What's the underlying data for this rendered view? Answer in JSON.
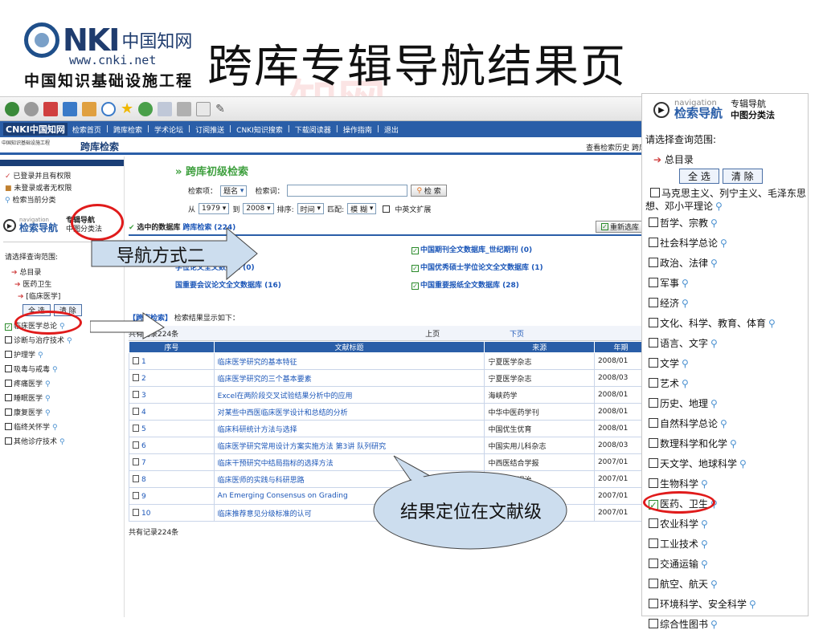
{
  "slide": {
    "title": "跨库专辑导航结果页",
    "watermark": "知网"
  },
  "logo": {
    "mark": "NKI",
    "cn_short": "中国知网",
    "url": "www.cnki.net",
    "cn_full": "中国知识基础设施工程"
  },
  "browser": {
    "nav_logo": "CNKI中国知网",
    "nav_items": [
      "检索首页",
      "跨库检索",
      "学术论坛",
      "订阅推送",
      "CNKI知识搜索",
      "下载阅读器",
      "操作指南",
      "退出"
    ],
    "site_sub": "中国知识基础设施工程",
    "page_title": "跨库检索",
    "history_link": "查看检索历史",
    "history_link2": "跨库"
  },
  "left_panel": {
    "status": [
      "已登录并且有权限",
      "未登录或者无权限",
      "检索当前分类"
    ],
    "nav_small": "navigation",
    "nav_title": "检索导航",
    "nav_side1": "专辑导航",
    "nav_side2": "中图分类法",
    "scope_label": "请选择查询范围:",
    "tree": [
      "总目录",
      "医药卫生",
      "[临床医学]"
    ],
    "select_all": "全 选",
    "clear": "清 除",
    "categories": [
      {
        "label": "临床医学总论",
        "checked": true
      },
      {
        "label": "诊断与治疗技术",
        "checked": false
      },
      {
        "label": "护理学",
        "checked": false
      },
      {
        "label": "吸毒与戒毒",
        "checked": false
      },
      {
        "label": "疼痛医学",
        "checked": false
      },
      {
        "label": "睡眠医学",
        "checked": false
      },
      {
        "label": "康复医学",
        "checked": false
      },
      {
        "label": "临终关怀学",
        "checked": false
      },
      {
        "label": "其他诊疗技术",
        "checked": false
      }
    ]
  },
  "search": {
    "section_title": "跨库初级检索",
    "field_label": "检索项：",
    "field_value": "题名",
    "term_label": "检索词：",
    "search_button": "检 索",
    "from_label": "从",
    "from_year": "1979",
    "to_label": "到",
    "to_year": "2008",
    "sort_label": "排序:",
    "sort_value": "时间",
    "match_label": "匹配:",
    "match_value": "模 糊",
    "expand_label": "中英文扩展"
  },
  "databases": {
    "label": "选中的数据库",
    "link": "跨库检索",
    "count": "(224)",
    "reselect": "重新选库",
    "items": [
      {
        "label": "期刊全文数据库 (179)"
      },
      {
        "label": "中国期刊全文数据库_世纪期刊 (0)"
      },
      {
        "label": "学位论文全文数据库 (0)"
      },
      {
        "label": "中国优秀硕士学位论文全文数据库 (1)"
      },
      {
        "label": "国重要会议论文全文数据库 (16)"
      },
      {
        "label": "中国重要报纸全文数据库 (28)"
      }
    ]
  },
  "results": {
    "heading_tag": "【跨库检索】",
    "heading_text": "检索结果显示如下：",
    "total_top": "共有记录224条",
    "prev": "上页",
    "next": "下页",
    "columns": [
      "序号",
      "文献标题",
      "来源",
      "年期"
    ],
    "rows": [
      {
        "n": "1",
        "title": "临床医学研究的基本特征",
        "source": "宁夏医学杂志",
        "year": "2008/01"
      },
      {
        "n": "2",
        "title": "临床医学研究的三个基本要素",
        "source": "宁夏医学杂志",
        "year": "2008/03"
      },
      {
        "n": "3",
        "title": "Excel在两阶段交叉试验结果分析中的应用",
        "source": "海峡药学",
        "year": "2008/01"
      },
      {
        "n": "4",
        "title": "对某些中西医临床医学设计和总结的分析",
        "source": "中华中医药学刊",
        "year": "2008/01"
      },
      {
        "n": "5",
        "title": "临床科研统计方法与选择",
        "source": "中国优生优育",
        "year": "2008/01"
      },
      {
        "n": "6",
        "title": "临床医学研究常用设计方案实施方法 第3讲 队列研究",
        "source": "中国实用儿科杂志",
        "year": "2008/03"
      },
      {
        "n": "7",
        "title": "临床干预研究中结局指标的选择方法",
        "source": "中西医结合学报",
        "year": "2007/01"
      },
      {
        "n": "8",
        "title": "临床医师的实践与科研思路",
        "source": "临床误诊误治",
        "year": "2007/01"
      },
      {
        "n": "9",
        "title": "An Emerging Consensus on Grading",
        "source": "志",
        "year": "2007/01"
      },
      {
        "n": "10",
        "title": "临床推荐意见分级标准的认可",
        "source": "",
        "year": "2007/01"
      }
    ],
    "total_bottom": "共有记录224条"
  },
  "right_panel": {
    "nav_small": "navigation",
    "nav_title": "检索导航",
    "side1": "专辑导航",
    "side2": "中图分类法",
    "scope_label": "请选择查询范围:",
    "root": "总目录",
    "select_all": "全 选",
    "clear": "清 除",
    "categories": [
      {
        "label": "马克思主义、列宁主义、毛泽东思想、邓小平理论",
        "checked": false
      },
      {
        "label": "哲学、宗教",
        "checked": false
      },
      {
        "label": "社会科学总论",
        "checked": false
      },
      {
        "label": "政治、法律",
        "checked": false
      },
      {
        "label": "军事",
        "checked": false
      },
      {
        "label": "经济",
        "checked": false
      },
      {
        "label": "文化、科学、教育、体育",
        "checked": false
      },
      {
        "label": "语言、文字",
        "checked": false
      },
      {
        "label": "文学",
        "checked": false
      },
      {
        "label": "艺术",
        "checked": false
      },
      {
        "label": "历史、地理",
        "checked": false
      },
      {
        "label": "自然科学总论",
        "checked": false
      },
      {
        "label": "数理科学和化学",
        "checked": false
      },
      {
        "label": "天文学、地球科学",
        "checked": false
      },
      {
        "label": "生物科学",
        "checked": false
      },
      {
        "label": "医药、卫生",
        "checked": true
      },
      {
        "label": "农业科学",
        "checked": false
      },
      {
        "label": "工业技术",
        "checked": false
      },
      {
        "label": "交通运输",
        "checked": false
      },
      {
        "label": "航空、航天",
        "checked": false
      },
      {
        "label": "环境科学、安全科学",
        "checked": false
      },
      {
        "label": "综合性图书",
        "checked": false
      }
    ]
  },
  "callouts": {
    "nav_mode": "导航方式二",
    "result_level": "结果定位在文献级"
  },
  "colors": {
    "accent_blue": "#2a5ea8",
    "highlight_red": "#e01b1b",
    "callout_fill": "#ccddee",
    "section_green": "#3fa03f"
  }
}
